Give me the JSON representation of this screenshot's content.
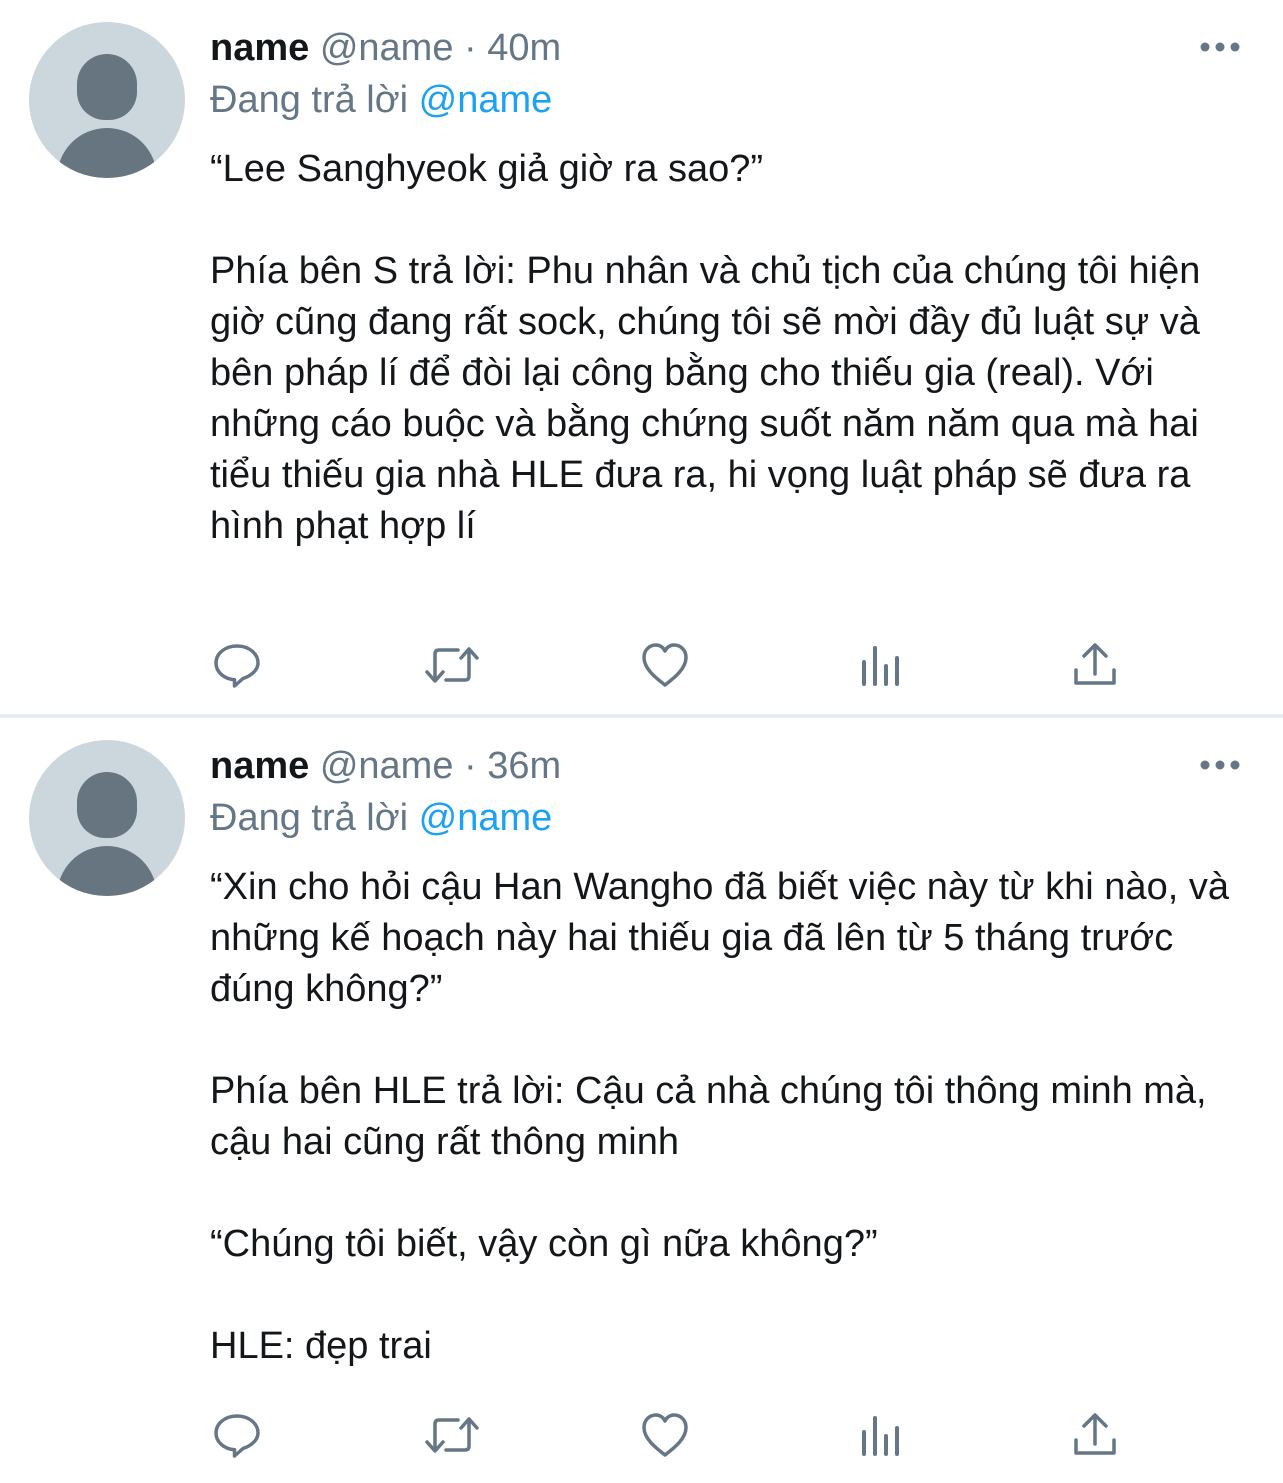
{
  "tweets": [
    {
      "display_name": "name",
      "handle": "@name",
      "separator": "·",
      "time": "40m",
      "replying_prefix": "Đang trả lời",
      "replying_to": "@name",
      "text": "“Lee Sanghyeok giả giờ ra sao?”\n\nPhía bên S trả lời: Phu nhân và chủ tịch của chúng tôi hiện giờ cũng đang rất sock, chúng tôi sẽ mời đầy đủ luật sự và bên pháp lí để đòi lại công bằng cho thiếu gia (real). Với những cáo buộc và bằng chứng suốt năm năm qua mà hai tiểu thiếu gia nhà HLE đưa ra, hi vọng luật pháp sẽ đưa ra hình phạt hợp lí",
      "actions": [
        "reply-icon",
        "retweet-icon",
        "like-icon",
        "analytics-icon",
        "share-icon"
      ]
    },
    {
      "display_name": "name",
      "handle": "@name",
      "separator": "·",
      "time": "36m",
      "replying_prefix": "Đang trả lời",
      "replying_to": "@name",
      "text": "“Xin cho hỏi cậu Han Wangho đã biết việc này từ khi nào, và những kế hoạch này hai thiếu gia đã lên từ 5 tháng trước đúng không?”\n\nPhía bên HLE trả lời: Cậu cả nhà chúng tôi thông minh mà, cậu hai cũng rất thông minh\n\n“Chúng tôi biết, vậy còn gì nữa không?”\n\nHLE: đẹp trai",
      "actions": [
        "reply-icon",
        "retweet-icon",
        "like-icon",
        "analytics-icon",
        "share-icon"
      ]
    }
  ],
  "colors": {
    "text": "#14171a",
    "secondary": "#657786",
    "link": "#1da1f2",
    "avatar_bg": "#ccd6dd",
    "avatar_fg": "#66757f",
    "divider": "#e6ecf0"
  }
}
